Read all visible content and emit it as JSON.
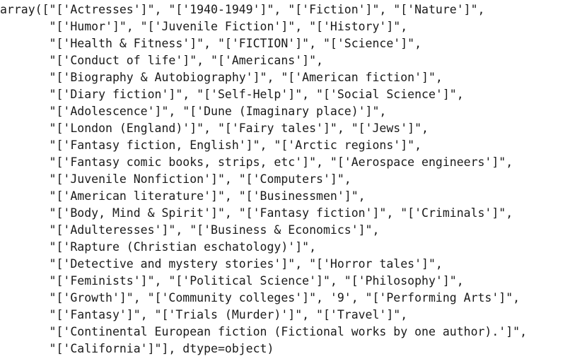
{
  "output": {
    "lines": [
      "array([\"['Actresses']\", \"['1940-1949']\", \"['Fiction']\", \"['Nature']\",",
      "       \"['Humor']\", \"['Juvenile Fiction']\", \"['History']\",",
      "       \"['Health & Fitness']\", \"['FICTION']\", \"['Science']\",",
      "       \"['Conduct of life']\", \"['Americans']\",",
      "       \"['Biography & Autobiography']\", \"['American fiction']\",",
      "       \"['Diary fiction']\", \"['Self-Help']\", \"['Social Science']\",",
      "       \"['Adolescence']\", \"['Dune (Imaginary place)']\",",
      "       \"['London (England)']\", \"['Fairy tales']\", \"['Jews']\",",
      "       \"['Fantasy fiction, English']\", \"['Arctic regions']\",",
      "       \"['Fantasy comic books, strips, etc']\", \"['Aerospace engineers']\",",
      "       \"['Juvenile Nonfiction']\", \"['Computers']\",",
      "       \"['American literature']\", \"['Businessmen']\",",
      "       \"['Body, Mind & Spirit']\", \"['Fantasy fiction']\", \"['Criminals']\",",
      "       \"['Adulteresses']\", \"['Business & Economics']\",",
      "       \"['Rapture (Christian eschatology)']\",",
      "       \"['Detective and mystery stories']\", \"['Horror tales']\",",
      "       \"['Feminists']\", \"['Political Science']\", \"['Philosophy']\",",
      "       \"['Growth']\", \"['Community colleges']\", '9', \"['Performing Arts']\",",
      "       \"['Fantasy']\", \"['Trials (Murder)']\", \"['Travel']\",",
      "       \"['Continental European fiction (Fictional works by one author).']\",",
      "       \"['California']\"], dtype=object)"
    ]
  }
}
